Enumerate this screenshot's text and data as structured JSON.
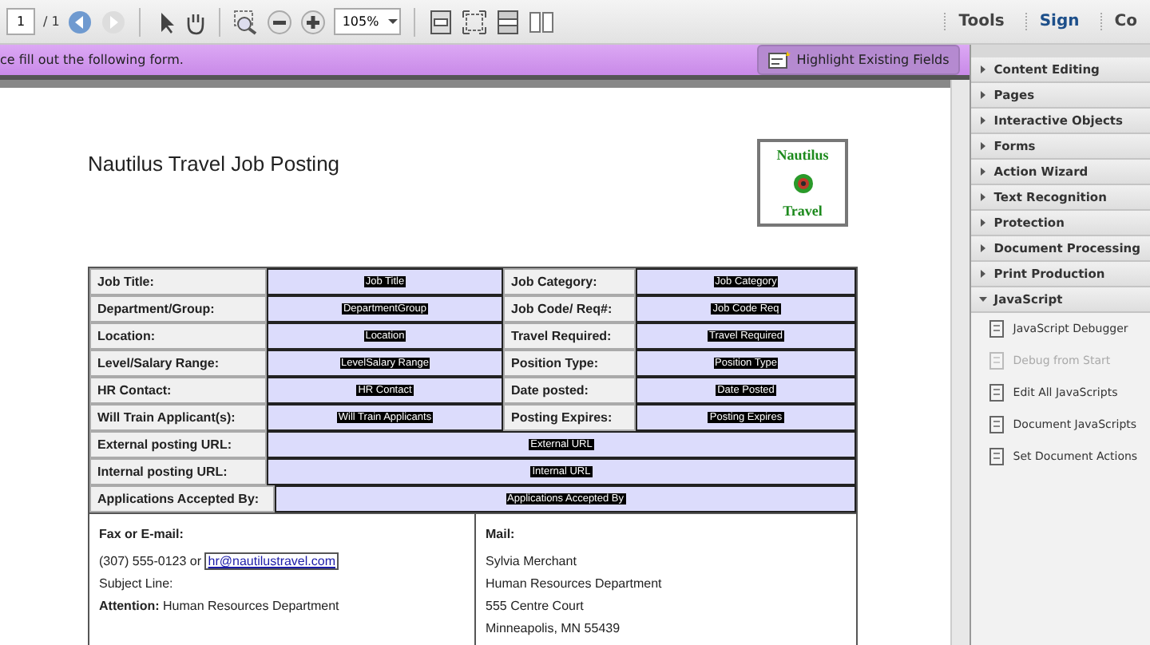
{
  "toolbar": {
    "page_field": "1",
    "page_total": "/ 1",
    "zoom": "105%",
    "links": [
      {
        "label": "Tools",
        "selected": false
      },
      {
        "label": "Sign",
        "selected": true
      },
      {
        "label": "Co",
        "selected": false
      }
    ]
  },
  "form_bar": {
    "message": "ce fill out the following form.",
    "button": "Highlight Existing Fields"
  },
  "document": {
    "title": "Nautilus Travel Job Posting",
    "logo": [
      "Nautilus",
      "Travel"
    ],
    "pair_rows": [
      {
        "label_1": "Job Title:",
        "field_1": "Job Title",
        "label_2": "Job Category:",
        "field_2": "Job Category"
      },
      {
        "label_1": "Department/Group:",
        "field_1": "DepartmentGroup",
        "label_2": "Job Code/ Req#:",
        "field_2": "Job Code Req"
      },
      {
        "label_1": "Location:",
        "field_1": "Location",
        "label_2": "Travel Required:",
        "field_2": "Travel Required"
      },
      {
        "label_1": "Level/Salary Range:",
        "field_1": "LevelSalary Range",
        "label_2": "Position Type:",
        "field_2": "Position Type"
      },
      {
        "label_1": "HR Contact:",
        "field_1": "HR Contact",
        "label_2": "Date posted:",
        "field_2": "Date Posted"
      },
      {
        "label_1": "Will Train Applicant(s):",
        "field_1": "Will Train Applicants",
        "label_2": "Posting Expires:",
        "field_2": "Posting Expires"
      }
    ],
    "wide_rows": [
      {
        "label": "External posting URL:",
        "field": "External URL"
      },
      {
        "label": "Internal posting URL:",
        "field": "Internal URL"
      },
      {
        "label": "Applications Accepted By:",
        "field": "Applications Accepted By"
      }
    ],
    "contact": {
      "left_heading": "Fax or E-mail:",
      "phone": "(307) 555-0123 or",
      "email": "hr@nautilustravel.com",
      "subject": "Subject Line:",
      "attention": "**Attention:** Human Resources Department",
      "right_heading": "Mail:",
      "address": [
        "Sylvia Merchant",
        "Human Resources Department",
        "555 Centre Court",
        "Minneapolis, MN 55439"
      ]
    }
  },
  "panel": {
    "sections": [
      {
        "label": "Content Editing",
        "expanded": false
      },
      {
        "label": "Pages",
        "expanded": false
      },
      {
        "label": "Interactive Objects",
        "expanded": false
      },
      {
        "label": "Forms",
        "expanded": false
      },
      {
        "label": "Action Wizard",
        "expanded": false
      },
      {
        "label": "Text Recognition",
        "expanded": false
      },
      {
        "label": "Protection",
        "expanded": false
      },
      {
        "label": "Document Processing",
        "expanded": false
      },
      {
        "label": "Print Production",
        "expanded": false
      },
      {
        "label": "JavaScript",
        "expanded": true
      }
    ],
    "tools": [
      {
        "label": "JavaScript Debugger",
        "disabled": false
      },
      {
        "label": "Debug from Start",
        "disabled": true
      },
      {
        "label": "Edit All JavaScripts",
        "disabled": false
      },
      {
        "label": "Document JavaScripts",
        "disabled": false
      },
      {
        "label": "Set Document Actions",
        "disabled": false
      }
    ]
  }
}
